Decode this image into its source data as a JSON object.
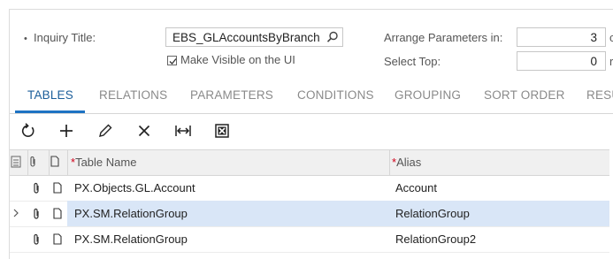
{
  "form": {
    "inquiry_title_label": "Inquiry Title:",
    "inquiry_title_value": "EBS_GLAccountsByBranch",
    "make_visible_label": "Make Visible on the UI",
    "make_visible_checked": true,
    "arrange_params_label": "Arrange Parameters in:",
    "arrange_params_value": "3",
    "arrange_params_suffix": "c",
    "select_top_label": "Select Top:",
    "select_top_value": "0",
    "select_top_suffix": "r"
  },
  "tabs": [
    {
      "label": "TABLES",
      "active": true
    },
    {
      "label": "RELATIONS",
      "active": false
    },
    {
      "label": "PARAMETERS",
      "active": false
    },
    {
      "label": "CONDITIONS",
      "active": false
    },
    {
      "label": "GROUPING",
      "active": false
    },
    {
      "label": "SORT ORDER",
      "active": false
    },
    {
      "label": "RESU",
      "active": false
    }
  ],
  "toolbar": {
    "icons": [
      "refresh-icon",
      "add-icon",
      "edit-icon",
      "delete-icon",
      "fit-to-screen-icon",
      "export-excel-icon"
    ]
  },
  "grid": {
    "columns": {
      "table_name": "Table Name",
      "alias": "Alias",
      "required_mark": "*"
    },
    "rows": [
      {
        "table_name": "PX.Objects.GL.Account",
        "alias": "Account",
        "selected": false
      },
      {
        "table_name": "PX.SM.RelationGroup",
        "alias": "RelationGroup",
        "selected": true
      },
      {
        "table_name": "PX.SM.RelationGroup",
        "alias": "RelationGroup2",
        "selected": false
      }
    ]
  },
  "colors": {
    "accent": "#1d72c3",
    "active_tab_text": "#1b5e9a",
    "selected_row": "#d9e6f7",
    "required_star": "#d0021b"
  }
}
